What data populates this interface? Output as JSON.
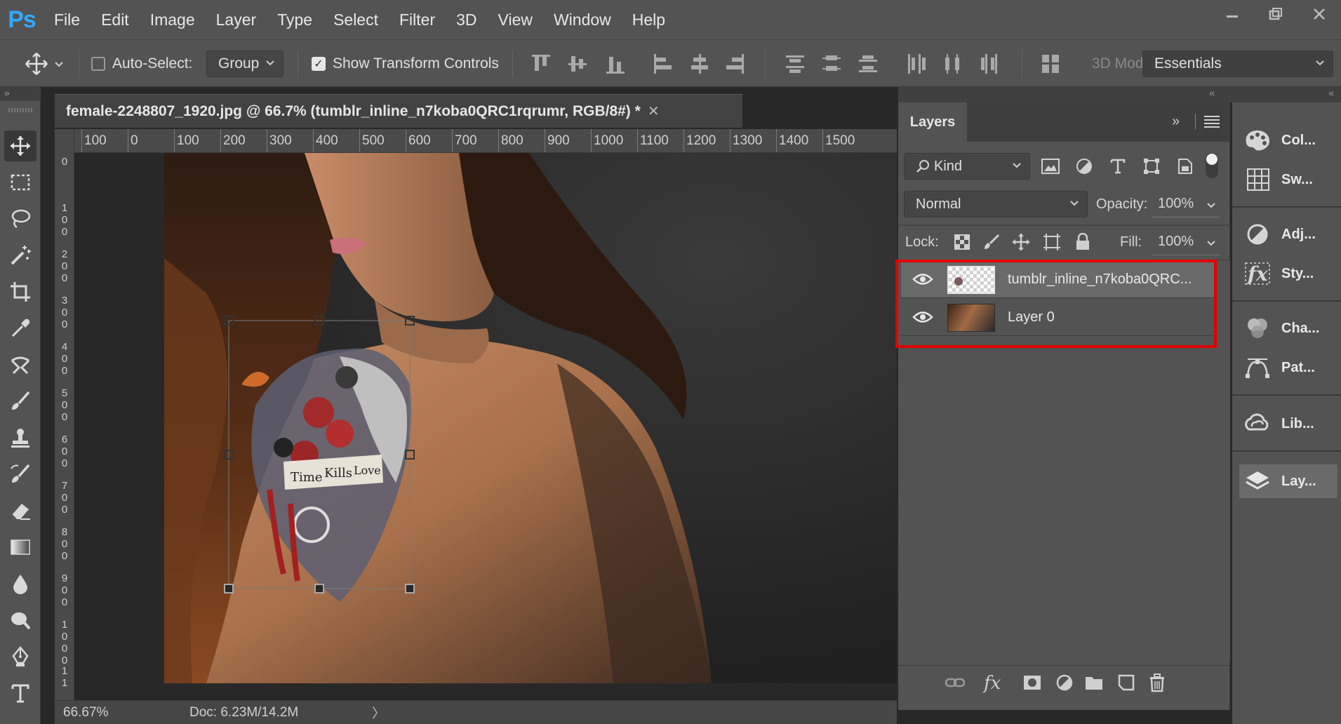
{
  "app": {
    "logo": "Ps",
    "menu": [
      "File",
      "Edit",
      "Image",
      "Layer",
      "Type",
      "Select",
      "Filter",
      "3D",
      "View",
      "Window",
      "Help"
    ],
    "window_controls": [
      "minimize-icon",
      "restore-icon",
      "close-icon"
    ]
  },
  "options_bar": {
    "auto_select_label": "Auto-Select:",
    "auto_select_checked": false,
    "auto_select_target": "Group",
    "show_transform_label": "Show Transform Controls",
    "show_transform_checked": true,
    "mode_3d_label": "3D Mod",
    "workspace": "Essentials"
  },
  "tools": [
    "move-tool-icon",
    "marquee-tool-icon",
    "lasso-tool-icon",
    "magic-wand-icon",
    "crop-tool-icon",
    "eyedropper-icon",
    "healing-brush-icon",
    "brush-tool-icon",
    "clone-stamp-icon",
    "history-brush-icon",
    "eraser-icon",
    "gradient-icon",
    "blur-icon",
    "dodge-icon",
    "pen-tool-icon",
    "type-tool-icon"
  ],
  "document": {
    "tab_title": "female-2248807_1920.jpg @ 66.7% (tumblr_inline_n7koba0QRC1rqrumr, RGB/8#) *",
    "ruler_h_labels": [
      "100",
      "0",
      "100",
      "200",
      "300",
      "400",
      "500",
      "600",
      "700",
      "800",
      "900",
      "1000",
      "1100",
      "1200",
      "1300",
      "1400",
      "1500"
    ],
    "ruler_v_labels": [
      "0",
      "1\n0\n0",
      "2\n0\n0",
      "3\n0\n0",
      "4\n0\n0",
      "5\n0\n0",
      "6\n0\n0",
      "7\n0\n0",
      "8\n0\n0",
      "9\n0\n0",
      "1\n0\n0\n0",
      "1\n1"
    ],
    "zoom": "66.67%",
    "doc_size": "Doc: 6.23M/14.2M",
    "status_arrow": "〉",
    "tattoo_text": [
      "Time",
      "Kills",
      "Love"
    ]
  },
  "layers_panel": {
    "tab_label": "Layers",
    "filter_kind": "Kind",
    "blend_mode": "Normal",
    "opacity_label": "Opacity:",
    "opacity_value": "100%",
    "lock_label": "Lock:",
    "fill_label": "Fill:",
    "fill_value": "100%",
    "layers": [
      {
        "name": "tumblr_inline_n7koba0QRC...",
        "visible": true,
        "selected": true
      },
      {
        "name": "Layer 0",
        "visible": true,
        "selected": false
      }
    ],
    "highlight_color": "#e10000"
  },
  "dock": {
    "items": [
      {
        "label": "Col...",
        "icon": "color-palette-icon"
      },
      {
        "label": "Sw...",
        "icon": "swatches-icon"
      },
      {
        "label": "Adj...",
        "icon": "adjustments-icon"
      },
      {
        "label": "Sty...",
        "icon": "styles-fx-icon"
      },
      {
        "label": "Cha...",
        "icon": "channels-icon"
      },
      {
        "label": "Pat...",
        "icon": "paths-icon"
      },
      {
        "label": "Lib...",
        "icon": "libraries-icon"
      },
      {
        "label": "Lay...",
        "icon": "layers-icon"
      }
    ]
  }
}
